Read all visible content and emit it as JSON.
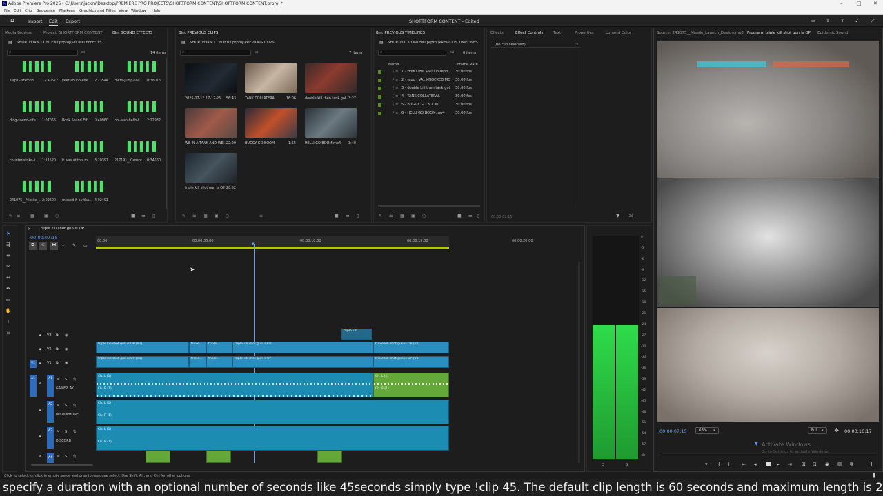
{
  "window": {
    "title": "Adobe Premiere Pro 2025 - C:\\Users\\jackm\\Desktop\\PREMIERE PRO PROJECTS\\SHORTFORM CONTENT\\SHORTFORM CONTENT.prproj *",
    "controls": [
      "–",
      "□",
      "✕"
    ]
  },
  "menu": [
    "File",
    "Edit",
    "Clip",
    "Sequence",
    "Markers",
    "Graphics and Titles",
    "View",
    "Window",
    "Help"
  ],
  "header": {
    "workspaces": [
      "Import",
      "Edit",
      "Export"
    ],
    "active": "Edit",
    "document_title": "SHORTFORM CONTENT - Edited"
  },
  "panel_sfx": {
    "tabs": [
      "Media Browser",
      "Project: SHORTFORM CONTENT",
      "Bin: SOUND EFFECTS"
    ],
    "path": "SHORTFORM CONTENT.prproj\\SOUND EFFECTS",
    "count": "14 items",
    "items": [
      {
        "name": "slaps - sfxmp3",
        "dur": "12:40672"
      },
      {
        "name": "yeet-sound-effe...",
        "dur": "2:23544"
      },
      {
        "name": "mero-jump-sou...",
        "dur": "0:38016"
      },
      {
        "name": "ding-sound-effe...",
        "dur": "1:07056"
      },
      {
        "name": "Bonk Sound Eff...",
        "dur": "0:40960"
      },
      {
        "name": "obi-wan-hello-t...",
        "dur": "2:22932"
      },
      {
        "name": "counter-strike-ji...",
        "dur": "1:11520"
      },
      {
        "name": "It was at this m...",
        "dur": "3:20397"
      },
      {
        "name": "217191__Censor...",
        "dur": "0:34560"
      },
      {
        "name": "241075__Missile_...",
        "dur": "2:09600"
      },
      {
        "name": "missed-it-by-tha...",
        "dur": "4:02491"
      }
    ]
  },
  "panel_clips": {
    "tab": "Bin: PREVIOUS CLIPS",
    "path": "SHORTFORM CONTENT.prproj\\PREVIOUS CLIPS",
    "count": "7 items",
    "items": [
      {
        "name": "2025-07-13 17-12-25...",
        "dur": "56:43"
      },
      {
        "name": "TANK COLLATERAL",
        "dur": "16:06"
      },
      {
        "name": "double kill then tank got...",
        "dur": "3:27"
      },
      {
        "name": "WE IN A TANK AND WE...",
        "dur": "22:29"
      },
      {
        "name": "BUGGY GO BOOM",
        "dur": "1:55"
      },
      {
        "name": "HELLI GO BOOM.mp4",
        "dur": "3:40"
      },
      {
        "name": "triple kill shot gun is OP",
        "dur": "20:52"
      }
    ]
  },
  "panel_timelines": {
    "tab": "Bin: PREVIOUS TIMELINES",
    "path": "SHORTFO...CONTENT.prproj\\PREVIOUS TIMELINES",
    "count": "6 items",
    "col_name": "Name",
    "col_rate": "Frame Rate",
    "rows": [
      {
        "name": "1 - How i lost $600 in repo",
        "rate": "30.00 fps"
      },
      {
        "name": "2 - repo - VAL KNOCKED ME",
        "rate": "30.00 fps"
      },
      {
        "name": "3 - double kill then tank got",
        "rate": "30.00 fps"
      },
      {
        "name": "4 - TANK COLLATERAL",
        "rate": "30.00 fps"
      },
      {
        "name": "5 - BUGGY GO BOOM",
        "rate": "30.00 fps"
      },
      {
        "name": "6 - HELLI GO BOOM.mp4",
        "rate": "30.00 fps"
      }
    ]
  },
  "panel_effects": {
    "tabs": [
      "Effects",
      "Effect Controls",
      "Text",
      "Properties",
      "Lumetri Color"
    ],
    "no_clip": "(no clip selected)",
    "timecode": "00:00:07:15"
  },
  "panel_program": {
    "tabs": [
      "Source: 241075__Missile_Launch_Design.mp3",
      "Program: triple kill shot gun is OP",
      "Epidemic Sound"
    ],
    "timecode": "00:00:07:15",
    "zoom": "63%",
    "quality": "Full",
    "duration": "00:00:16:17",
    "watermark1": "Activate Windows",
    "watermark2": "Go to Settings to activate Windows."
  },
  "timeline": {
    "sequence": "triple kill shot gun is OP",
    "timecode": "00:00:07:15",
    "ruler": [
      "00:00",
      "00:00:05:00",
      "00:00:10:00",
      "00:00:15:00",
      "00:00:20:00"
    ],
    "tracks": [
      {
        "id": "V3",
        "name": ""
      },
      {
        "id": "V2",
        "name": ""
      },
      {
        "id": "V1",
        "name": ""
      },
      {
        "id": "A1",
        "name": "GAMEPLAY"
      },
      {
        "id": "A2",
        "name": "MICROPHONE"
      },
      {
        "id": "A3",
        "name": "DISCORD"
      },
      {
        "id": "A4",
        "name": ""
      }
    ],
    "clip_v2": "triple kill shot gun is OP [V2]",
    "clip_v1": "triple kill shot gun is OP [V1]",
    "clip_v2_mid": "triple kill shot gun is OP",
    "clip_v3": "triple kill...",
    "clip_short": "triple...",
    "ch_l": "Ch. L (1)",
    "ch_r": "Ch. R (1)",
    "fx": "fx",
    "meter_ticks": [
      "0",
      "-3",
      "-6",
      "-9",
      "-12",
      "-15",
      "-18",
      "-21",
      "-24",
      "-27",
      "-30",
      "-33",
      "-36",
      "-39",
      "-42",
      "-45",
      "-48",
      "-51",
      "-54",
      "-57",
      "dB"
    ],
    "meter_level": 0.6
  },
  "status": "Click to select, or click in empty space and drag to marquee select. Use Shift, Alt, and Ctrl for other options.",
  "caption": "specify a duration with an optional number of seconds like 45seconds simply type !clip 45. The default clip length is 60 seconds and maximum length is 240 seconds",
  "colors": {
    "accent": "#2d8ceb",
    "clip_blue": "#2a8ec1",
    "clip_green": "#64a83a",
    "meter_green": "#3fdc55"
  }
}
